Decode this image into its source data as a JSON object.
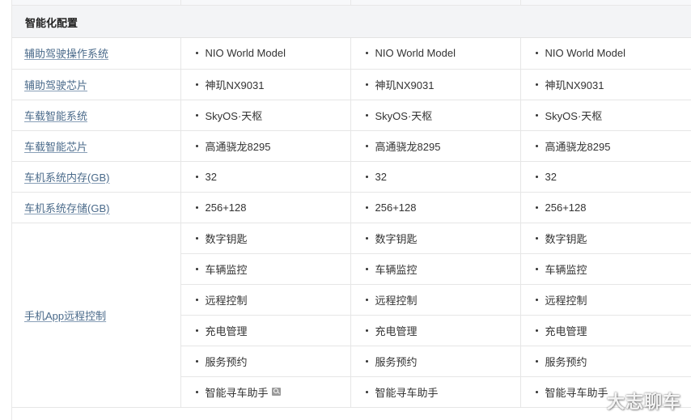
{
  "section": {
    "title": "智能化配置"
  },
  "rows": [
    {
      "label": "辅助驾驶操作系统",
      "values": [
        "NIO World Model",
        "NIO World Model",
        "NIO World Model"
      ]
    },
    {
      "label": "辅助驾驶芯片",
      "values": [
        "神玑NX9031",
        "神玑NX9031",
        "神玑NX9031"
      ]
    },
    {
      "label": "车载智能系统",
      "values": [
        "SkyOS·天枢",
        "SkyOS·天枢",
        "SkyOS·天枢"
      ]
    },
    {
      "label": "车载智能芯片",
      "values": [
        "高通骁龙8295",
        "高通骁龙8295",
        "高通骁龙8295"
      ]
    },
    {
      "label": "车机系统内存(GB)",
      "values": [
        "32",
        "32",
        "32"
      ]
    },
    {
      "label": "车机系统存储(GB)",
      "values": [
        "256+128",
        "256+128",
        "256+128"
      ]
    }
  ],
  "remote_control": {
    "label": "手机App远程控制",
    "items": [
      [
        "数字钥匙",
        "数字钥匙",
        "数字钥匙"
      ],
      [
        "车辆监控",
        "车辆监控",
        "车辆监控"
      ],
      [
        "远程控制",
        "远程控制",
        "远程控制"
      ],
      [
        "充电管理",
        "充电管理",
        "充电管理"
      ],
      [
        "服务预约",
        "服务预约",
        "服务预约"
      ],
      [
        "智能寻车助手",
        "智能寻车助手",
        "智能寻车助手"
      ]
    ]
  },
  "icons": {
    "magnify": "magnifier-icon"
  },
  "watermark": "大志聊车",
  "colors": {
    "section_bg": "#f3f4f6",
    "label_link": "#4a6a8a",
    "border": "#e6e6e6"
  }
}
